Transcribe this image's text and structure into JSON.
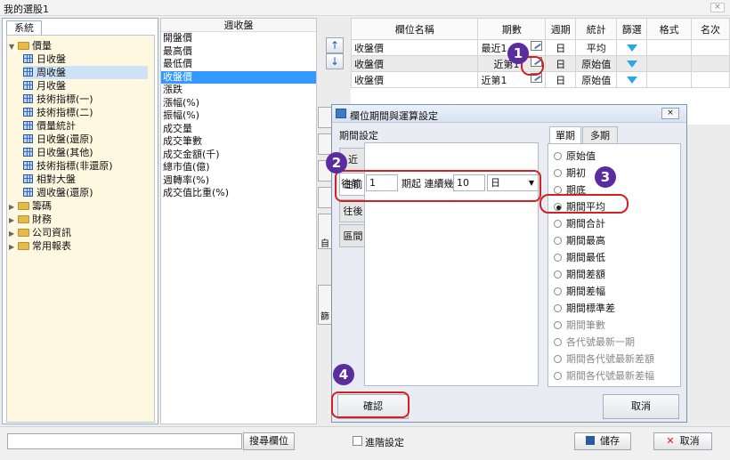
{
  "window": {
    "title": "我的選股1",
    "close_label": "×"
  },
  "tree": {
    "tab_label": "系統",
    "nodes": [
      {
        "label": "價量",
        "type": "folder",
        "expanded": true,
        "level": 0
      },
      {
        "label": "日收盤",
        "type": "table",
        "level": 1
      },
      {
        "label": "周收盤",
        "type": "table",
        "level": 1,
        "selected": true
      },
      {
        "label": "月收盤",
        "type": "table",
        "level": 1
      },
      {
        "label": "技術指標(一)",
        "type": "table",
        "level": 1
      },
      {
        "label": "技術指標(二)",
        "type": "table",
        "level": 1
      },
      {
        "label": "價量統計",
        "type": "table",
        "level": 1
      },
      {
        "label": "日收盤(還原)",
        "type": "table",
        "level": 1
      },
      {
        "label": "日收盤(其他)",
        "type": "table",
        "level": 1
      },
      {
        "label": "技術指標(非還原)",
        "type": "table",
        "level": 1
      },
      {
        "label": "相對大盤",
        "type": "table",
        "level": 1
      },
      {
        "label": "週收盤(還原)",
        "type": "table",
        "level": 1
      },
      {
        "label": "籌碼",
        "type": "folder",
        "level": 0
      },
      {
        "label": "財務",
        "type": "folder",
        "level": 0
      },
      {
        "label": "公司資訊",
        "type": "folder",
        "level": 0
      },
      {
        "label": "常用報表",
        "type": "folder",
        "level": 0
      }
    ]
  },
  "fields": {
    "header": "週收盤",
    "items": [
      "開盤價",
      "最高價",
      "最低價",
      "收盤價",
      "漲跌",
      "漲幅(%)",
      "振幅(%)",
      "成交量",
      "成交筆數",
      "成交金額(千)",
      "總市值(億)",
      "週轉率(%)",
      "成交值比重(%)"
    ],
    "selected_index": 3
  },
  "move_buttons": {
    "up": "↑",
    "down": "↓"
  },
  "grid": {
    "headers": [
      "欄位名稱",
      "期數",
      "週期",
      "統計",
      "篩選",
      "格式",
      "名次"
    ],
    "rows": [
      {
        "name": "收盤價",
        "period": "最近1",
        "cycle": "日",
        "stat": "平均"
      },
      {
        "name": "收盤價",
        "period": "近第1",
        "cycle": "日",
        "stat": "原始值"
      },
      {
        "name": "收盤價",
        "period": "近第1",
        "cycle": "日",
        "stat": "原始值"
      }
    ]
  },
  "side_tabs": [
    "自",
    "篩"
  ],
  "dialog": {
    "title": "欄位期間與運算設定",
    "close_label": "×",
    "period_section_label": "期間設定",
    "vtabs": [
      "近",
      "往前",
      "往後",
      "區間"
    ],
    "row": {
      "prefix": "往前",
      "value": "1",
      "mid_label": "期起 連續幾",
      "count": "10",
      "unit": "日"
    },
    "right_tabs": [
      "單期",
      "多期"
    ],
    "options": [
      {
        "label": "原始值",
        "enabled": true
      },
      {
        "label": "期初",
        "enabled": true
      },
      {
        "label": "期底",
        "enabled": true
      },
      {
        "label": "期間平均",
        "enabled": true,
        "checked": true
      },
      {
        "label": "期間合計",
        "enabled": true
      },
      {
        "label": "期間最高",
        "enabled": true
      },
      {
        "label": "期間最低",
        "enabled": true
      },
      {
        "label": "期間差額",
        "enabled": true
      },
      {
        "label": "期間差幅",
        "enabled": true
      },
      {
        "label": "期間標準差",
        "enabled": true
      },
      {
        "label": "期間筆數",
        "enabled": false
      },
      {
        "label": "各代號最新一期",
        "enabled": false
      },
      {
        "label": "期間各代號最新差額",
        "enabled": false
      },
      {
        "label": "期間各代號最新差幅",
        "enabled": false
      }
    ],
    "confirm_label": "確認",
    "cancel_label": "取消"
  },
  "annotations": [
    "1",
    "2",
    "3",
    "4"
  ],
  "bottom": {
    "search_value": "",
    "search_button": "搜尋欄位",
    "advanced_label": "進階設定",
    "save_label": "儲存",
    "cancel_label": "取消"
  },
  "colors": {
    "highlight_red": "#d32020",
    "badge_purple": "#5b2ca0",
    "selection_blue": "#3399ff",
    "filter_cyan": "#29a8e8"
  }
}
